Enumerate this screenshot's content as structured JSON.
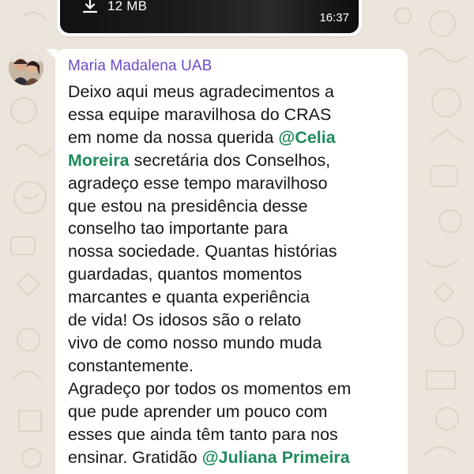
{
  "video_message": {
    "file_size": "12 MB",
    "time": "16:37",
    "download_icon": "download-icon"
  },
  "message": {
    "sender": "Maria Madalena UAB",
    "lines": [
      [
        {
          "t": "Deixo aqui meus agradecimentos a"
        }
      ],
      [
        {
          "t": "essa equipe maravilhosa do CRAS"
        }
      ],
      [
        {
          "t": "em nome da nossa querida "
        },
        {
          "t": "@Celia",
          "mention": true
        }
      ],
      [
        {
          "t": "Moreira",
          "mention": true
        },
        {
          "t": " secretária dos Conselhos,"
        }
      ],
      [
        {
          "t": "agradeço esse tempo maravilhoso"
        }
      ],
      [
        {
          "t": "que estou na presidência desse"
        }
      ],
      [
        {
          "t": "conselho tao importante para"
        }
      ],
      [
        {
          "t": "nossa sociedade. Quantas histórias"
        }
      ],
      [
        {
          "t": "guardadas, quantos momentos"
        }
      ],
      [
        {
          "t": "marcantes e quanta experiência"
        }
      ],
      [
        {
          "t": "de vida! Os idosos são o relato"
        }
      ],
      [
        {
          "t": "vivo de como nosso mundo muda"
        }
      ],
      [
        {
          "t": "constantemente."
        }
      ],
      [
        {
          "t": "Agradeço por todos os momentos em"
        }
      ],
      [
        {
          "t": "que pude aprender um pouco com"
        }
      ],
      [
        {
          "t": "esses que ainda têm tanto para nos"
        }
      ],
      [
        {
          "t": "ensinar. Gratidão "
        },
        {
          "t": "@Juliana Primeira",
          "mention": true
        }
      ]
    ]
  },
  "colors": {
    "background": "#ece5dc",
    "sender_name": "#6b4bc7",
    "mention": "#1e8a5a",
    "bubble": "#ffffff"
  }
}
